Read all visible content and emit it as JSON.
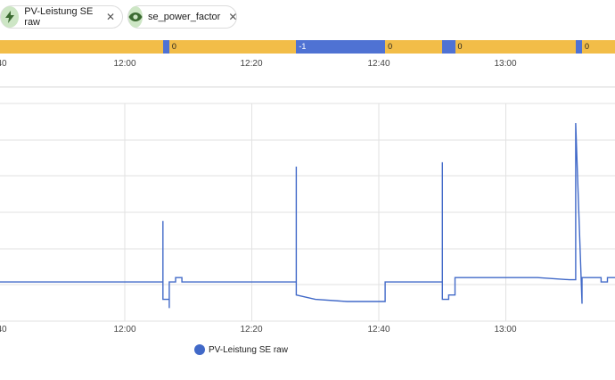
{
  "chips": [
    {
      "label": "PV-Leistung SE raw",
      "icon": "lightning-bolt-icon"
    },
    {
      "label": "se_power_factor",
      "icon": "eye-icon"
    }
  ],
  "timeline": [
    {
      "value": "",
      "color": "#f2bd48",
      "from": "11:35",
      "to": "12:06"
    },
    {
      "value": "",
      "color": "#4f72d3",
      "from": "12:06",
      "to": "12:07"
    },
    {
      "value": "0",
      "color": "#f2bd48",
      "from": "12:07",
      "to": "12:27"
    },
    {
      "value": "-1",
      "color": "#4f72d3",
      "from": "12:27",
      "to": "12:41"
    },
    {
      "value": "0",
      "color": "#f2bd48",
      "from": "12:41",
      "to": "12:50"
    },
    {
      "value": "",
      "color": "#4f72d3",
      "from": "12:50",
      "to": "12:52"
    },
    {
      "value": "0",
      "color": "#f2bd48",
      "from": "12:52",
      "to": "13:11"
    },
    {
      "value": "",
      "color": "#4f72d3",
      "from": "13:11",
      "to": "13:12"
    },
    {
      "value": "0",
      "color": "#f2bd48",
      "from": "13:12",
      "to": "13:20"
    }
  ],
  "axis_ticks": [
    "40",
    "12:00",
    "12:20",
    "12:40",
    "13:00"
  ],
  "legend": {
    "label": "PV-Leistung SE raw",
    "color": "#4169c8"
  },
  "chart_data": {
    "type": "line",
    "title": "",
    "xlabel": "",
    "ylabel": "",
    "x_range": [
      "11:35",
      "13:20"
    ],
    "y_range": [
      0,
      100
    ],
    "grid": true,
    "legend_position": "bottom",
    "series": [
      {
        "name": "PV-Leistung SE raw",
        "color": "#4169c8",
        "points": [
          [
            "11:35",
            18
          ],
          [
            "11:40",
            18
          ],
          [
            "11:50",
            18
          ],
          [
            "12:00",
            18
          ],
          [
            "12:06",
            18
          ],
          [
            "12:06",
            46
          ],
          [
            "12:06",
            10
          ],
          [
            "12:07",
            10
          ],
          [
            "12:07",
            6
          ],
          [
            "12:07",
            18
          ],
          [
            "12:08",
            18
          ],
          [
            "12:08",
            20
          ],
          [
            "12:09",
            20
          ],
          [
            "12:09",
            18
          ],
          [
            "12:15",
            18
          ],
          [
            "12:27",
            18
          ],
          [
            "12:27",
            71
          ],
          [
            "12:27",
            12
          ],
          [
            "12:30",
            10
          ],
          [
            "12:35",
            9
          ],
          [
            "12:40",
            9
          ],
          [
            "12:41",
            9
          ],
          [
            "12:41",
            18
          ],
          [
            "12:50",
            18
          ],
          [
            "12:50",
            73
          ],
          [
            "12:50",
            10
          ],
          [
            "12:51",
            10
          ],
          [
            "12:51",
            12
          ],
          [
            "12:52",
            12
          ],
          [
            "12:52",
            20
          ],
          [
            "12:58",
            20
          ],
          [
            "13:05",
            20
          ],
          [
            "13:10",
            19
          ],
          [
            "13:11",
            19
          ],
          [
            "13:11",
            91
          ],
          [
            "13:12",
            8
          ],
          [
            "13:12",
            20
          ],
          [
            "13:15",
            20
          ],
          [
            "13:15",
            18
          ],
          [
            "13:16",
            18
          ],
          [
            "13:16",
            20
          ],
          [
            "13:20",
            20
          ]
        ]
      }
    ]
  }
}
